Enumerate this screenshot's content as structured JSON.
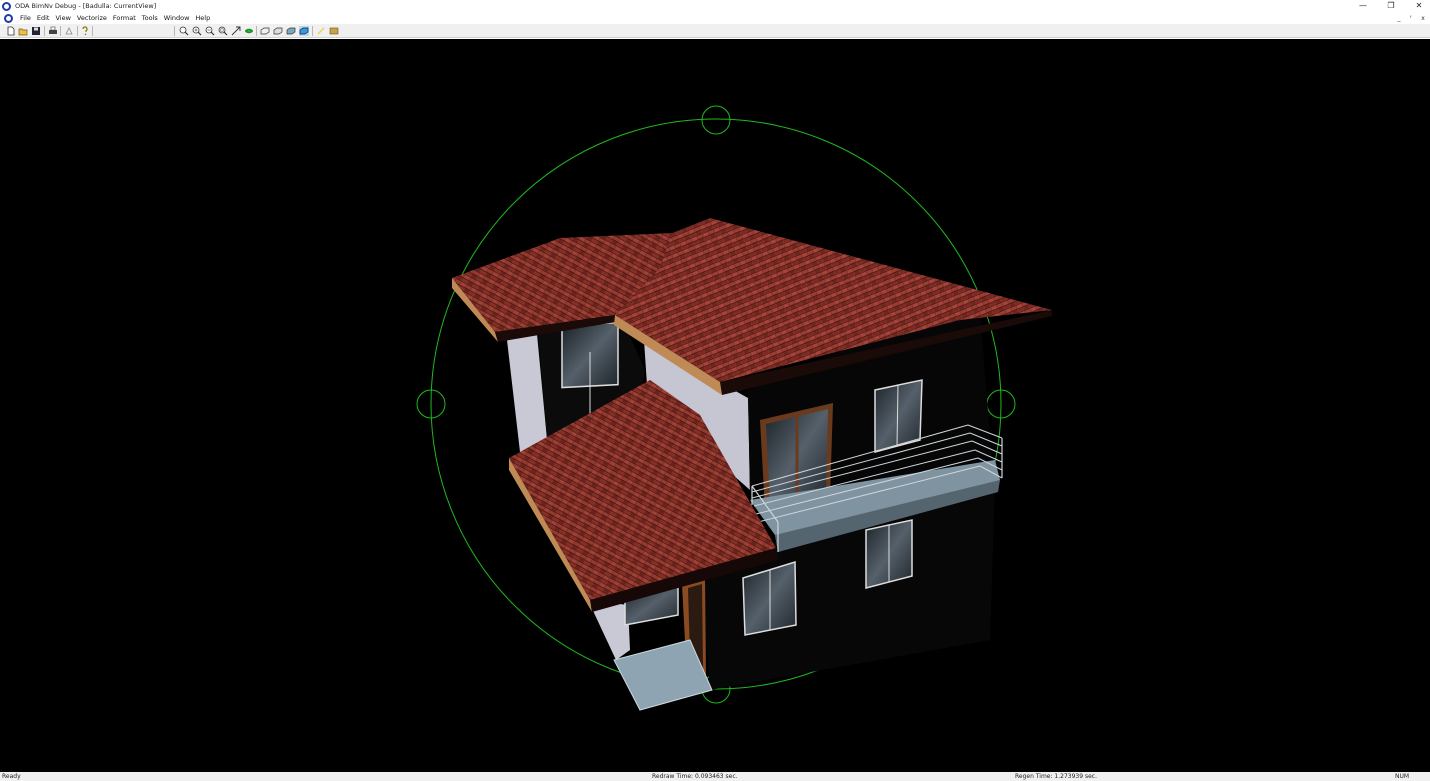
{
  "window": {
    "title": "ODA BimNv Debug - [Badulla: CurrentView]",
    "controls": [
      "—",
      "❐",
      "✕"
    ]
  },
  "menu": {
    "items": [
      "File",
      "Edit",
      "View",
      "Vectorize",
      "Format",
      "Tools",
      "Window",
      "Help"
    ],
    "mdi_controls": [
      "_",
      "ᶠ",
      "x"
    ]
  },
  "toolbar": {
    "buttons": [
      "new-icon",
      "open-icon",
      "save-icon",
      "print-icon",
      "print-preview-icon",
      "help-icon",
      "zoom-extents-icon",
      "zoom-in-icon",
      "zoom-out-icon",
      "zoom-window-icon",
      "pan-icon",
      "orbit-icon",
      "wireframe-icon",
      "hidden-icon",
      "flat-shaded-icon",
      "gouraud-shaded-icon",
      "light-icon",
      "render-icon"
    ]
  },
  "viewport": {
    "background": "#000000",
    "orbit_color": "#1fb81f",
    "roof_color": "#8c3228",
    "wall_color": "#0a0a0a",
    "plaster_color": "#c8c8d4"
  },
  "status": {
    "ready": "Ready",
    "redraw_time": "Redraw Time: 0.093463 sec.",
    "regen_time": "Regen Time: 1.273939 sec.",
    "num": "NUM"
  }
}
